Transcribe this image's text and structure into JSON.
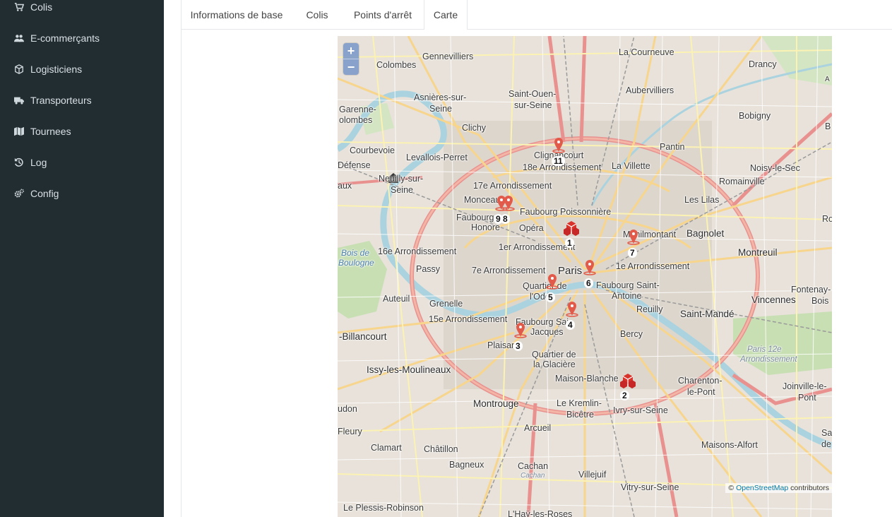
{
  "sidebar": {
    "items": [
      {
        "label": "Colis",
        "icon": "cart-icon"
      },
      {
        "label": "E-commerçants",
        "icon": "users-icon"
      },
      {
        "label": "Logisticiens",
        "icon": "cube-icon"
      },
      {
        "label": "Transporteurs",
        "icon": "truck-icon"
      },
      {
        "label": "Tournees",
        "icon": "map-icon"
      },
      {
        "label": "Log",
        "icon": "history-icon"
      },
      {
        "label": "Config",
        "icon": "cogs-icon"
      }
    ]
  },
  "tabs": [
    {
      "label": "Informations de base",
      "active": false
    },
    {
      "label": "Colis",
      "active": false
    },
    {
      "label": "Points d'arrêt",
      "active": false
    },
    {
      "label": "Carte",
      "active": true
    }
  ],
  "map": {
    "zoom_in": "+",
    "zoom_out": "−",
    "places": {
      "gennevilliers": "Gennevilliers",
      "la_courneuve": "La Courneuve",
      "drancy": "Drancy",
      "colombes": "Colombes",
      "asnieres": "Asnières-sur-",
      "asnieres2": "Seine",
      "saint_ouen": "Saint-Ouen-",
      "saint_ouen2": "sur-Seine",
      "aubervilliers": "Aubervilliers",
      "bobigny": "Bobigny",
      "garenne": "Garenne-",
      "garenne2": "olombes",
      "clichy": "Clichy",
      "pantin": "Pantin",
      "courbevoie": "Courbevoie",
      "levallois": "Levallois-Perret",
      "clignancourt": "Clignancourt",
      "arr18": "18e Arrondissement",
      "la_villette": "La Villette",
      "noisy": "Noisy-le-Sec",
      "defense": "Défense",
      "neuilly": "Neuilly-sur-",
      "neuilly2": "Seine",
      "arr17": "17e Arrondissement",
      "romainville": "Romainville",
      "aux": "aux",
      "les_lilas": "Les Lilas",
      "monceau": "Monceau",
      "faubourg_poissonniere": "Faubourg Poissonnière",
      "faubourg_honore": "Faubourg",
      "faubourg_honore2": "Honore",
      "opera": "Opéra",
      "menilmontant": "Ménilmontant",
      "bagnolet": "Bagnolet",
      "bois_boulogne": "Bois de",
      "bois_boulogne2": "Boulogne",
      "arr16": "16e Arrondissement",
      "arr1": "1er Arrondissement",
      "montreuil": "Montreuil",
      "arr11": "1e Arrondissement",
      "passy": "Passy",
      "arr7": "7e Arrondissement",
      "paris": "Paris",
      "fontenay": "Fontenay-",
      "fontenay2": "Bois",
      "quartier_odeon": "Quartier de",
      "quartier_odeon2": "l'Odé",
      "faubourg_antoine": "Faubourg Saint-",
      "faubourg_antoine2": "Antoine",
      "auteuil": "Auteuil",
      "grenelle": "Grenelle",
      "reuilly": "Reuilly",
      "vincennes": "Vincennes",
      "saint_mande": "Saint-Mandé",
      "arr15": "15e Arrondissement",
      "faubourg_jacques": "Faubourg Sai",
      "faubourg_jacques2": "Jacques",
      "bercy": "Bercy",
      "billancourt": "-Billancourt",
      "plaisance": "Plaisan",
      "glaciere": "Quartier de",
      "glaciere2": "la Glacière",
      "paris12": "Paris 12e",
      "paris12b": "Arrondissement",
      "issy": "Issy-les-Moulineaux",
      "maison_blanche": "Maison-Blanche",
      "charenton": "Charenton-",
      "charenton2": "le-Pont",
      "joinville": "Joinville-le-",
      "joinville2": "Pont",
      "udon": "udon",
      "montrouge": "Montrouge",
      "kremlin": "Le Kremlin-",
      "kremlin2": "Bicêtre",
      "ivry": "Ivry-sur-Seine",
      "fleury": "Fleury",
      "arcueil": "Arcueil",
      "sai": "Sai",
      "de": "de",
      "clamart": "Clamart",
      "chatillon": "Châtillon",
      "maisons_alfort": "Maisons-Alfort",
      "bagneux": "Bagneux",
      "cachan": "Cachan",
      "cachan2": "Cachan",
      "villejuif": "Villejuif",
      "vitry": "Vitry-sur-Seine",
      "plessis": "Le Plessis-Robinson",
      "hay": "L'Haÿ-les-Roses",
      "a": "A",
      "b": "B",
      "ro": "Ro"
    },
    "markers": [
      {
        "label": "11",
        "kind": "pin"
      },
      {
        "label": "9",
        "kind": "pin"
      },
      {
        "label": "8",
        "kind": "pin"
      },
      {
        "label": "1",
        "kind": "warehouse"
      },
      {
        "label": "7",
        "kind": "pin"
      },
      {
        "label": "6",
        "kind": "pin"
      },
      {
        "label": "5",
        "kind": "pin"
      },
      {
        "label": "4",
        "kind": "pin"
      },
      {
        "label": "3",
        "kind": "pin"
      },
      {
        "label": "2",
        "kind": "warehouse"
      }
    ],
    "attribution_prefix": "©",
    "attribution_link": "OpenStreetMap",
    "attribution_suffix": "contributors"
  }
}
